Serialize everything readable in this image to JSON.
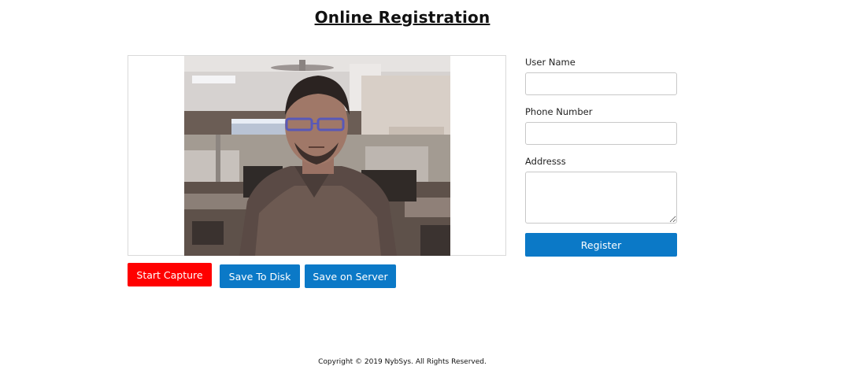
{
  "page": {
    "title": "Online Registration"
  },
  "camera": {
    "start_label": "Start Capture",
    "save_disk_label": "Save To Disk",
    "save_server_label": "Save on Server"
  },
  "form": {
    "username_label": "User Name",
    "username_value": "",
    "phone_label": "Phone Number",
    "phone_value": "",
    "address_label": "Addresss",
    "address_value": "",
    "register_label": "Register"
  },
  "footer": {
    "copyright": "Copyright © 2019 NybSys. All Rights Reserved."
  },
  "colors": {
    "capture_red": "#ff0000",
    "primary_blue": "#0b79c7"
  }
}
